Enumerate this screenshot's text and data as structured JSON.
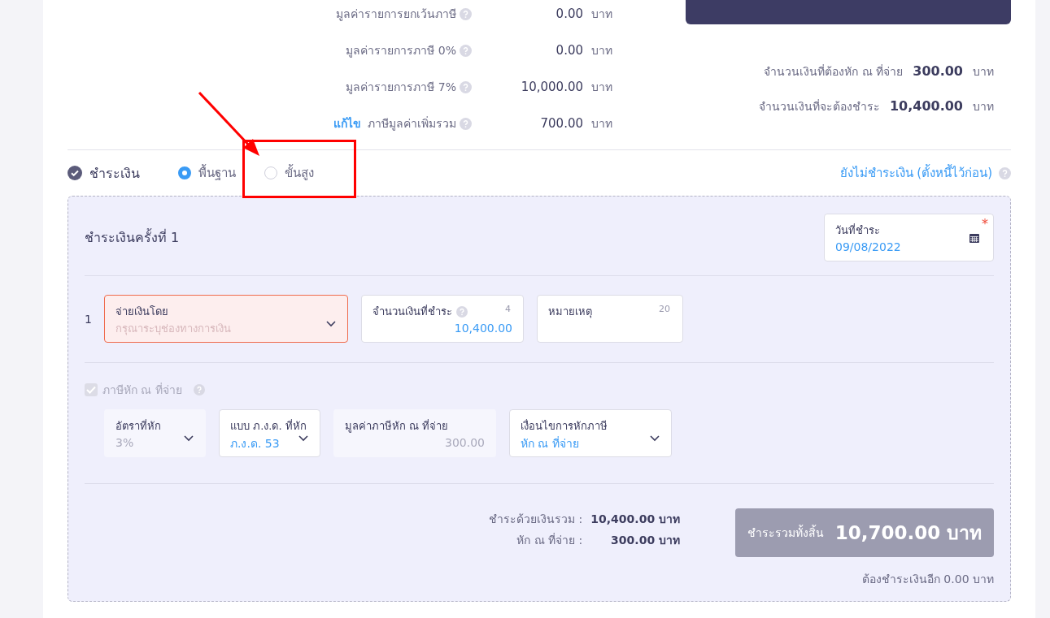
{
  "summary": {
    "rows": [
      {
        "label": "มูลค่ารายการยกเว้นภาษี",
        "amount": "0.00",
        "unit": "บาท"
      },
      {
        "label": "มูลค่ารายการภาษี 0%",
        "amount": "0.00",
        "unit": "บาท"
      },
      {
        "label": "มูลค่ารายการภาษี 7%",
        "amount": "10,000.00",
        "unit": "บาท"
      },
      {
        "edit_link": "แก้ไข",
        "label": "ภาษีมูลค่าเพิ่มรวม",
        "amount": "700.00",
        "unit": "บาท"
      }
    ]
  },
  "due": [
    {
      "label": "จำนวนเงินที่ต้องหัก ณ ที่จ่าย",
      "amount": "300.00",
      "unit": "บาท"
    },
    {
      "label": "จำนวนเงินที่จะต้องชำระ",
      "amount": "10,400.00",
      "unit": "บาท"
    }
  ],
  "payment": {
    "checked": true,
    "title": "ชำระเงิน",
    "modes": [
      {
        "label": "พื้นฐาน",
        "selected": true
      },
      {
        "label": "ขั้นสูง",
        "selected": false
      }
    ],
    "defer_link": "ยังไม่ชำระเงิน (ตั้งหนี้ไว้ก่อน)"
  },
  "installment": {
    "title": "ชำระเงินครั้งที่ 1",
    "date": {
      "label": "วันที่ชำระ",
      "value": "09/08/2022",
      "required_mark": "*"
    },
    "line": {
      "index": "1",
      "method": {
        "label": "จ่ายเงินโดย",
        "placeholder": "กรุณาระบุช่องทางการเงิน",
        "error": true
      },
      "amount": {
        "label": "จำนวนเงินที่ชำระ",
        "counter": "4",
        "value": "10,400.00"
      },
      "note": {
        "label": "หมายเหตุ",
        "counter": "20"
      }
    },
    "withholding": {
      "label": "ภาษีหัก ณ ที่จ่าย",
      "checked": true,
      "disabled": true,
      "fields": [
        {
          "kind": "select",
          "label": "อัตราที่หัก",
          "value": "3%",
          "disabled": true
        },
        {
          "kind": "select",
          "label": "แบบ ภ.ง.ด. ที่หัก",
          "value": "ภ.ง.ด. 53",
          "disabled": false
        },
        {
          "kind": "text",
          "label": "มูลค่าภาษีหัก ณ ที่จ่าย",
          "value": "300.00",
          "disabled": true
        },
        {
          "kind": "select",
          "label": "เงื่อนไขการหักภาษี",
          "value": "หัก ณ ที่จ่าย",
          "disabled": false
        }
      ]
    },
    "totals": [
      {
        "label": "ชำระด้วยเงินรวม :",
        "value": "10,400.00 บาท"
      },
      {
        "label": "หัก ณ ที่จ่าย :",
        "value": "300.00 บาท"
      }
    ],
    "grand_total": {
      "label": "ชำระรวมทั้งสิ้น",
      "value": "10,700.00 บาท"
    },
    "remaining": "ต้องชำระเงินอีก 0.00 บาท"
  }
}
